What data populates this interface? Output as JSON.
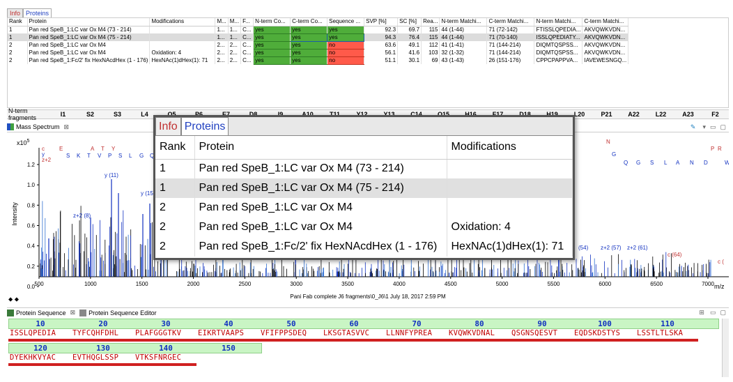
{
  "top_tabs": [
    "Info",
    "Proteins"
  ],
  "grid": {
    "headers": [
      "Rank",
      "Protein",
      "Modifications",
      "M...",
      "M...",
      "F...",
      "N-term Co...",
      "C-term Co...",
      "Sequence ...",
      "SVP [%]",
      "SC [%]",
      "Rea...",
      "N-term Matchi...",
      "C-term Matchi...",
      "N-term Matchi...",
      "C-term Matchi..."
    ],
    "rows": [
      {
        "rank": "1",
        "protein": "Pan red SpeB_1:LC var Ox M4 (73 - 214)",
        "mods": "",
        "m1": "1...",
        "m2": "1...",
        "f": "C...",
        "nterm": "yes",
        "cterm": "yes",
        "seq": "yes",
        "svp": "92.3",
        "sc": "69.7",
        "rea": "115",
        "ntm": "44 (1-44)",
        "ctm": "71 (72-142)",
        "ntm2": "FTISSLQPEDIA...",
        "ctm2": "AKVQWKVDN..."
      },
      {
        "rank": "1",
        "protein": "Pan red SpeB_1:LC var Ox M4 (75 - 214)",
        "mods": "",
        "m1": "1...",
        "m2": "1...",
        "f": "C...",
        "nterm": "yes",
        "cterm": "yes",
        "seq": "yes",
        "svp": "94.3",
        "sc": "76.4",
        "rea": "115",
        "ntm": "44 (1-44)",
        "ctm": "71 (70-140)",
        "ntm2": "ISSLQPEDIATY...",
        "ctm2": "AKVQWKVDN..."
      },
      {
        "rank": "2",
        "protein": "Pan red SpeB_1:LC var Ox M4",
        "mods": "",
        "m1": "2...",
        "m2": "2...",
        "f": "C...",
        "nterm": "yes",
        "cterm": "yes",
        "seq": "no",
        "svp": "63.6",
        "sc": "49.1",
        "rea": "112",
        "ntm": "41 (1-41)",
        "ctm": "71 (144-214)",
        "ntm2": "DIQMTQSPSS...",
        "ctm2": "AKVQWKVDN..."
      },
      {
        "rank": "2",
        "protein": "Pan red SpeB_1:LC var Ox M4",
        "mods": "Oxidation: 4",
        "m1": "2...",
        "m2": "2...",
        "f": "C...",
        "nterm": "yes",
        "cterm": "yes",
        "seq": "no",
        "svp": "56.1",
        "sc": "41.6",
        "rea": "103",
        "ntm": "32 (1-32)",
        "ctm": "71 (144-214)",
        "ntm2": "DIQMTQSPSS...",
        "ctm2": "AKVQWKVDN..."
      },
      {
        "rank": "2",
        "protein": "Pan red SpeB_1:Fc/2' fix HexNAcdHex (1 - 176)",
        "mods": "HexNAc(1)dHex(1): 71",
        "m1": "2...",
        "m2": "2...",
        "f": "C...",
        "nterm": "yes",
        "cterm": "yes",
        "seq": "no",
        "svp": "51.1",
        "sc": "30.1",
        "rea": "69",
        "ntm": "43 (1-43)",
        "ctm": "26 (151-176)",
        "ntm2": "CPPCPAPPVA...",
        "ctm2": "IAVEWESNGQ..."
      }
    ]
  },
  "fragments": {
    "label": "N-term fragments",
    "items": [
      "I1",
      "S2",
      "S3",
      "L4",
      "Q5",
      "P6",
      "E7",
      "D8",
      "I9",
      "A10",
      "T11",
      "Y12",
      "Y13",
      "C14",
      "Q15",
      "H16",
      "F17",
      "D18",
      "H19",
      "L20",
      "P21",
      "A22",
      "L22",
      "A23",
      "F2"
    ]
  },
  "spectrum": {
    "tab_label": "Mass Spectrum",
    "caption": "Pani Fab complete J6 fragments\\0_J6\\1 July 18, 2017 2:59 PM",
    "ylabel": "Intensity",
    "xlabel": "m/z",
    "exponent": "x10",
    "exponent_power": "5",
    "y_ticks": [
      "1.2",
      "1.0",
      "0.8",
      "0.6",
      "0.4",
      "0.2",
      "0.0"
    ],
    "x_ticks": [
      "500",
      "1000",
      "1500",
      "2000",
      "2500",
      "3000",
      "3500",
      "4000",
      "4500",
      "5000",
      "5500",
      "6000",
      "6500",
      "7000"
    ],
    "annotations": [
      "y (11)",
      "z+2 (8)",
      "y (15",
      "(54)",
      "z+2 (57)",
      "z+2 (61)",
      "c (64)",
      "c ("
    ],
    "ladder_top": [
      "E",
      "A",
      "T",
      "Y",
      "S",
      "K",
      "T",
      "V",
      "P",
      "S",
      "L",
      "G",
      "Q",
      "V",
      "N",
      "G",
      "Q",
      "G",
      "S",
      "L",
      "A",
      "N",
      "D",
      "P",
      "R",
      "W"
    ],
    "left_letters": [
      "c",
      "y",
      "z+2"
    ]
  },
  "sequence": {
    "tab_label": "Protein Sequence",
    "editor_tab_label": "Protein Sequence Editor",
    "numbers_row1": [
      "10",
      "20",
      "30",
      "40",
      "50",
      "60",
      "70",
      "80",
      "90",
      "100",
      "110"
    ],
    "blocks_row1": [
      "ISSLQPEDIA",
      "TYFCQHFDHL",
      "PLAFGGGTKV",
      "EIKRTVAAPS",
      "VFIFPPSDEQ",
      "LKSGTASVVC",
      "LLNNFYPREA",
      "KVQWKVDNAL",
      "QSGNSQESVT",
      "EQDSKDSTYS",
      "LSSTLTLSKA"
    ],
    "numbers_row2": [
      "120",
      "130",
      "140",
      "150"
    ],
    "blocks_row2": [
      "DYEKHKVYAC",
      "EVTHQGLSSP",
      "VTKSFNRGEC"
    ]
  },
  "zoom": {
    "tabs": [
      "Info",
      "Proteins"
    ],
    "headers": [
      "Rank",
      "Protein",
      "Modifications"
    ],
    "rows": [
      {
        "rank": "1",
        "protein": "Pan red SpeB_1:LC var Ox M4 (73 - 214)",
        "mods": ""
      },
      {
        "rank": "1",
        "protein": "Pan red SpeB_1:LC var Ox M4 (75 - 214)",
        "mods": ""
      },
      {
        "rank": "2",
        "protein": "Pan red SpeB_1:LC var Ox M4",
        "mods": ""
      },
      {
        "rank": "2",
        "protein": "Pan red SpeB_1:LC var Ox M4",
        "mods": "Oxidation: 4"
      },
      {
        "rank": "2",
        "protein": "Pan red SpeB_1:Fc/2' fix HexNAcdHex (1 - 176)",
        "mods": "HexNAc(1)dHex(1): 71"
      }
    ]
  }
}
